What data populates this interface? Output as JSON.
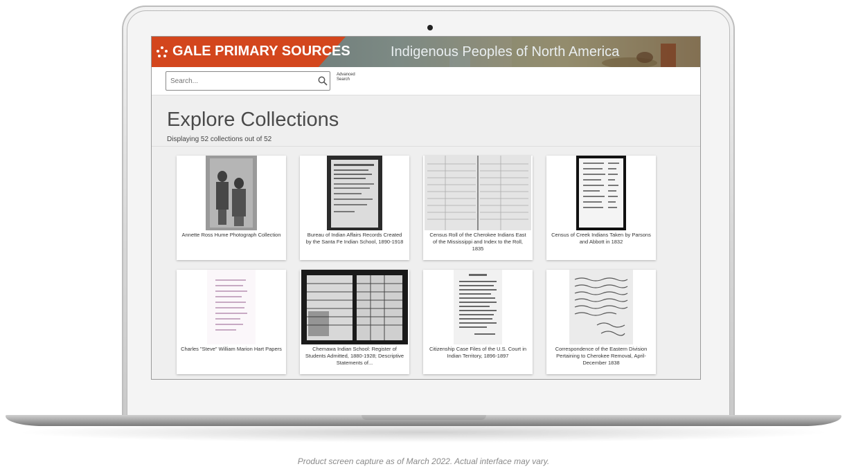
{
  "banner": {
    "brand": "GALE PRIMARY SOURCES",
    "collection": "Indigenous Peoples of North America"
  },
  "search": {
    "placeholder": "Search...",
    "advanced_line1": "Advanced",
    "advanced_line2": "Search"
  },
  "main": {
    "title": "Explore Collections",
    "count_text": "Displaying 52 collections out of 52"
  },
  "collections": [
    {
      "title": "Annette Ross Hume Photograph Collection"
    },
    {
      "title": "Bureau of Indian Affairs Records Created by the Santa Fe Indian School, 1890-1918"
    },
    {
      "title": "Census Roll of the Cherokee Indians East of the Mississippi and Index to the Roll, 1835"
    },
    {
      "title": "Census of Creek Indians Taken by Parsons and Abbott in 1832"
    },
    {
      "title": "Charles \"Steve\" William Marion Hart Papers"
    },
    {
      "title": "Chemawa Indian School: Register of Students Admitted, 1880-1928; Descriptive Statements of..."
    },
    {
      "title": "Citizenship Case Files of the U.S. Court in Indian Territory, 1896-1897"
    },
    {
      "title": "Correspondence of the Eastern Division Pertaining to Cherokee Removal, April-December 1838"
    }
  ],
  "caption": "Product screen capture as of March 2022. Actual interface may vary.",
  "colors": {
    "brand_orange": "#d3461d",
    "banner_slate": "#6f7d7f"
  }
}
